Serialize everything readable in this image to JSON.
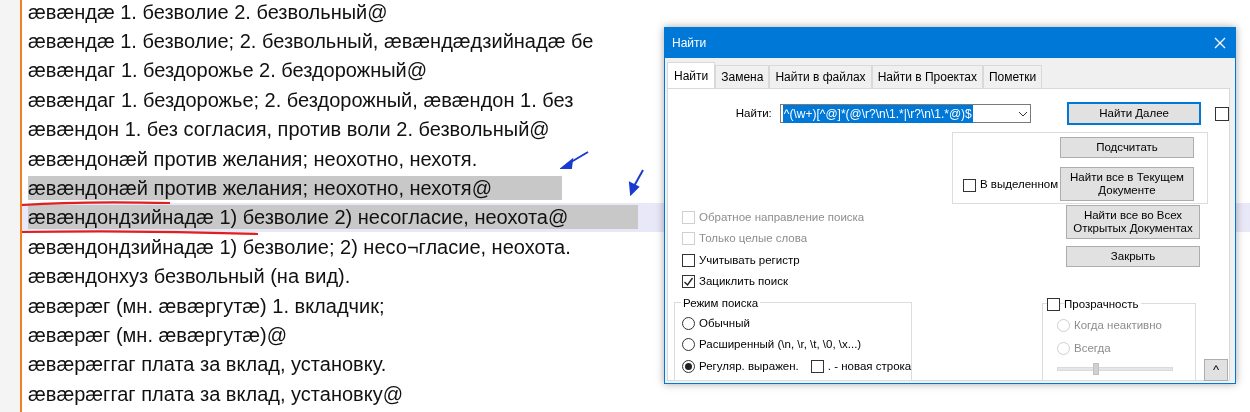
{
  "editor": {
    "lines": [
      {
        "text": "æвæндæ 1. безволие 2. безвольный@",
        "selected": false,
        "current": false
      },
      {
        "text": "æвæндæ 1. безволие; 2. безвольный, æвæндæдзийнадæ бе",
        "selected": false,
        "current": false
      },
      {
        "text": "æвæндаг 1. бездорожье 2. бездорожный@",
        "selected": false,
        "current": false
      },
      {
        "text": "æвæндаг 1. бездорожье; 2. бездорожный, æвæндон 1. без",
        "selected": false,
        "current": false
      },
      {
        "text": "æвæндон 1. без согласия, против воли 2. безвольный@",
        "selected": false,
        "current": false
      },
      {
        "text": "æвæндонæй против желания; неохотно, нехотя.",
        "selected": false,
        "current": false
      },
      {
        "text": "æвæндонæй против желания; неохотно, нехотя@",
        "selected": true,
        "current": false
      },
      {
        "text": "æвæндондзийнадæ 1) безволие 2) несогласие, неохота@",
        "selected": true,
        "current": true
      },
      {
        "text": "æвæндондзийнадæ 1) безволие; 2) несо¬гласие, неохота.",
        "selected": false,
        "current": false
      },
      {
        "text": "æвæндонхуз безвольный (на вид).",
        "selected": false,
        "current": false
      },
      {
        "text": "æвæрæг (мн. æвæргутæ) 1. вкладчик;",
        "selected": false,
        "current": false
      },
      {
        "text": "æвæрæг (мн. æвæргутæ)@",
        "selected": false,
        "current": false
      },
      {
        "text": "æвæрæггаг плата за вклад, установку.",
        "selected": false,
        "current": false
      },
      {
        "text": "æвæрæггаг плата за вклад, установку@",
        "selected": false,
        "current": false
      }
    ]
  },
  "dialog": {
    "title": "Найти",
    "tabs": [
      {
        "label": "Найти",
        "selected": true
      },
      {
        "label": "Замена",
        "selected": false
      },
      {
        "label": "Найти в файлах",
        "selected": false
      },
      {
        "label": "Найти в Проектах",
        "selected": false
      },
      {
        "label": "Пометки",
        "selected": false
      }
    ],
    "find": {
      "label": "Найти:",
      "value": "^(\\w+)[^@]*(@\\r?\\n\\1.*|\\r?\\n\\1.*@)$"
    },
    "find_next_button": "Найти Далее",
    "find_next_checkbox": {
      "checked": false
    },
    "count_button": "Подсчитать",
    "in_selection": {
      "label": "В выделенном",
      "checked": false
    },
    "find_all_current_button": "Найти все в Текущем Документе",
    "find_all_open_button": "Найти все во Всех Открытых Документах",
    "close_button": "Закрыть",
    "options": [
      {
        "label": "Обратное направление поиска",
        "checked": false,
        "disabled": true
      },
      {
        "label": "Только целые слова",
        "checked": false,
        "disabled": true
      },
      {
        "label": "Учитывать регистр",
        "checked": false,
        "disabled": false
      },
      {
        "label": "Зациклить поиск",
        "checked": true,
        "disabled": false
      }
    ],
    "search_mode": {
      "title": "Режим поиска",
      "modes": [
        {
          "label": "Обычный",
          "selected": false
        },
        {
          "label": "Расширенный (\\n, \\r, \\t, \\0, \\x...)",
          "selected": false
        },
        {
          "label": "Регуляр. выражен.",
          "selected": true
        }
      ],
      "dot_newline": {
        "label": ". - новая строка",
        "checked": false
      }
    },
    "transparency": {
      "label": "Прозрачность",
      "checked": false,
      "options": [
        {
          "label": "Когда неактивно",
          "selected": false,
          "disabled": true
        },
        {
          "label": "Всегда",
          "selected": false,
          "disabled": true
        }
      ],
      "slider": {
        "level": 0.32,
        "disabled": true
      }
    },
    "collapse_button": "^"
  }
}
